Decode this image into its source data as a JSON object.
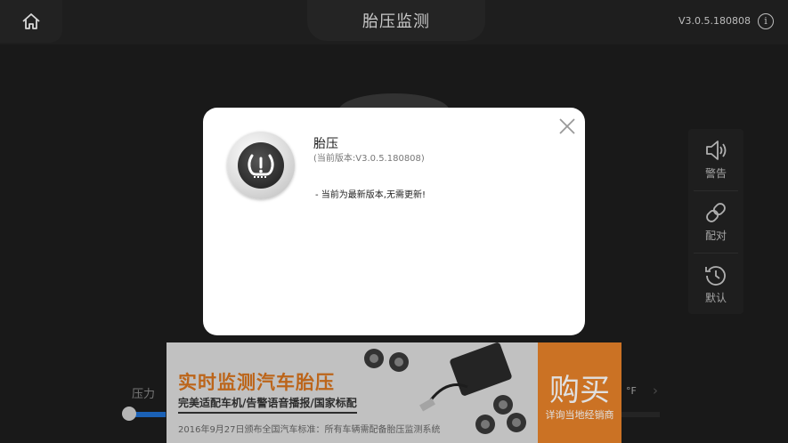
{
  "header": {
    "title": "胎压监测",
    "version": "V3.0.5.180808",
    "info_icon": "i"
  },
  "side_panel": {
    "items": [
      {
        "label": "警告",
        "icon": "speaker-icon"
      },
      {
        "label": "配对",
        "icon": "link-icon"
      },
      {
        "label": "默认",
        "icon": "history-icon"
      }
    ]
  },
  "main": {
    "pressure_label": "压力",
    "unit": "°F",
    "slider_value_percent": 2
  },
  "ad": {
    "headline": "实时监测汽车胎压",
    "subline": "完美适配车机/告警语音播报/国家标配",
    "fine_print": "2016年9月27日颁布全国汽车标准：所有车辆需配备胎压监测系统",
    "buy_label": "购买",
    "buy_sub": "详询当地经销商"
  },
  "dialog": {
    "app_name": "胎压",
    "version_text": "(当前版本:V3.0.5.180808)",
    "message": "- 当前为最新版本,无需更新!"
  },
  "colors": {
    "accent_orange": "#e8822a",
    "headline_orange": "#d6731e",
    "slider_blue": "#1f6fd0"
  }
}
